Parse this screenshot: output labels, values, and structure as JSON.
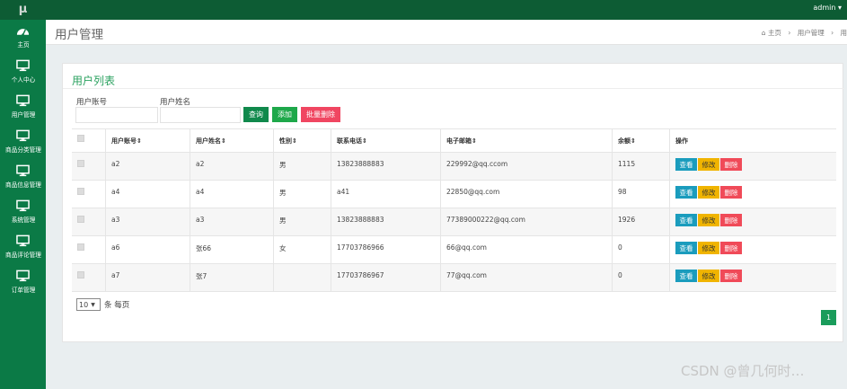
{
  "app": {
    "logo": "μ",
    "user": "admin ▾"
  },
  "sidebar": {
    "items": [
      {
        "label": "主页",
        "icon": "dashboard-icon"
      },
      {
        "label": "个人中心",
        "icon": "monitor-icon"
      },
      {
        "label": "用户管理",
        "icon": "monitor-icon"
      },
      {
        "label": "商品分类管理",
        "icon": "monitor-icon"
      },
      {
        "label": "商品信息管理",
        "icon": "monitor-icon"
      },
      {
        "label": "系统管理",
        "icon": "monitor-icon"
      },
      {
        "label": "商品评论管理",
        "icon": "monitor-icon"
      },
      {
        "label": "订单管理",
        "icon": "monitor-icon"
      }
    ]
  },
  "header": {
    "title": "用户管理",
    "breadcrumb": {
      "home": "主页",
      "current": "用户管理",
      "truncated": "用"
    }
  },
  "panel": {
    "title": "用户列表"
  },
  "filters": {
    "account_label": "用户账号",
    "name_label": "用户姓名",
    "account_value": "",
    "name_value": ""
  },
  "buttons": {
    "search": "查询",
    "add": "添加",
    "batch_delete": "批量删除"
  },
  "table": {
    "headers": [
      "用户账号",
      "用户姓名",
      "性别",
      "联系电话",
      "电子邮箱",
      "余额",
      "操作"
    ],
    "rows": [
      {
        "account": "a2",
        "name": "a2",
        "gender": "男",
        "phone": "13823888883",
        "email": "229992@qq.ccom",
        "balance": "1115"
      },
      {
        "account": "a4",
        "name": "a4",
        "gender": "男",
        "phone": "a41",
        "email": "22850@qq.com",
        "balance": "98"
      },
      {
        "account": "a3",
        "name": "a3",
        "gender": "男",
        "phone": "13823888883",
        "email": "77389000222@qq.com",
        "balance": "1926"
      },
      {
        "account": "a6",
        "name": "张66",
        "gender": "女",
        "phone": "17703786966",
        "email": "66@qq.com",
        "balance": "0"
      },
      {
        "account": "a7",
        "name": "张7",
        "gender": "",
        "phone": "17703786967",
        "email": "77@qq.com",
        "balance": "0"
      }
    ],
    "actions": {
      "view": "查看",
      "edit": "修改",
      "delete": "删除"
    }
  },
  "pagination": {
    "page_size": "10",
    "page_size_suffix": "条 每页",
    "current_page": "1"
  },
  "watermark": "CSDN @曾几何时…",
  "colors": {
    "sidebar": "#0b7a46",
    "topbar": "#0d5c34",
    "title_green": "#2aa15f",
    "view": "#1a9cbd",
    "edit": "#f0b400",
    "delete": "#f04a58"
  }
}
